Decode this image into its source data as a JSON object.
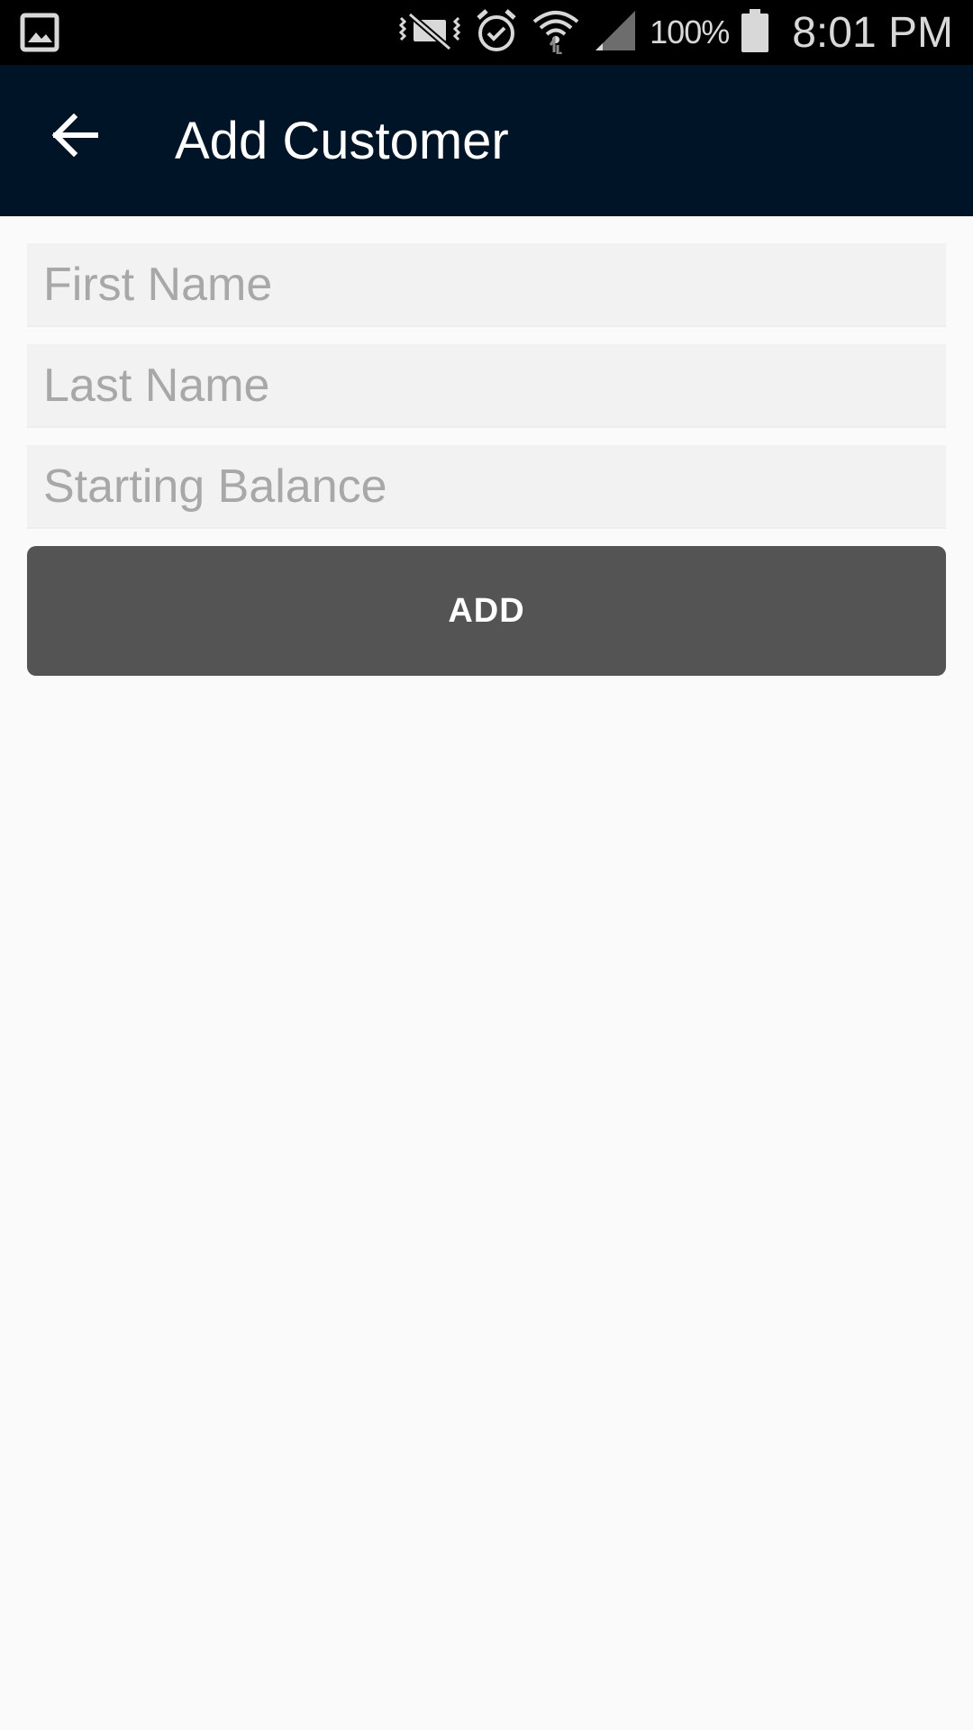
{
  "status_bar": {
    "battery_percent": "100%",
    "time": "8:01 PM",
    "icons": [
      "gallery-icon",
      "vibrate-mute-icon",
      "alarm-icon",
      "wifi-icon",
      "cell-signal-icon",
      "battery-icon"
    ]
  },
  "app_bar": {
    "title": "Add Customer",
    "background": "#001428"
  },
  "form": {
    "fields": [
      {
        "placeholder": "First Name",
        "value": ""
      },
      {
        "placeholder": "Last Name",
        "value": ""
      },
      {
        "placeholder": "Starting Balance",
        "value": ""
      }
    ],
    "submit_label": "ADD",
    "button_color": "#545454"
  }
}
